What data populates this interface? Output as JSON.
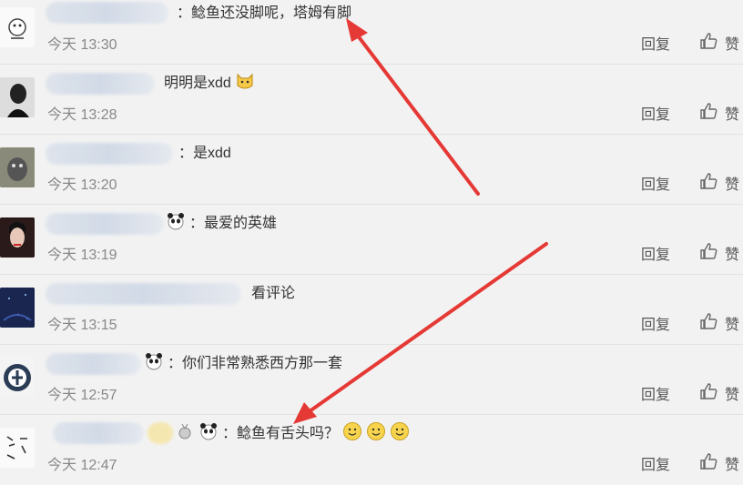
{
  "comments": [
    {
      "text": "：鲶鱼还没脚呢，塔姆有脚",
      "time": "今天 13:30",
      "reply": "回复",
      "like": "赞"
    },
    {
      "text": "明明是xdd",
      "time": "今天 13:28",
      "reply": "回复",
      "like": "赞"
    },
    {
      "text": "：是xdd",
      "time": "今天 13:20",
      "reply": "回复",
      "like": "赞"
    },
    {
      "text": "：最爱的英雄",
      "time": "今天 13:19",
      "reply": "回复",
      "like": "赞"
    },
    {
      "text": "看评论",
      "time": "今天 13:15",
      "reply": "回复",
      "like": "赞"
    },
    {
      "text": "：你们非常熟悉西方那一套",
      "time": "今天 12:57",
      "reply": "回复",
      "like": "赞"
    },
    {
      "text": "：鲶鱼有舌头吗？",
      "time": "今天 12:47",
      "reply": "回复",
      "like": "赞"
    }
  ],
  "icons": {
    "like": "thumbs-up-icon",
    "emoji_panda": "panda-emoji-icon",
    "emoji_smile": "smile-emoji-icon",
    "emoji_cat": "cat-emoji-icon"
  },
  "colors": {
    "arrow": "#e53935",
    "background": "#f2f2f2",
    "time": "#888888"
  }
}
